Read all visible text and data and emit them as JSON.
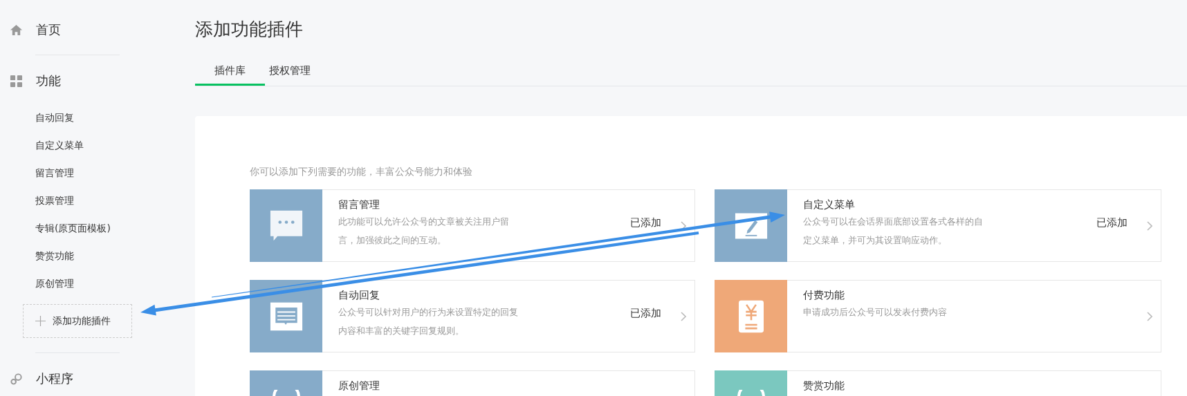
{
  "sidebar": {
    "sections": [
      {
        "kind": "home",
        "label": "首页"
      },
      {
        "kind": "grid",
        "label": "功能",
        "items": [
          {
            "label": "自动回复"
          },
          {
            "label": "自定义菜单"
          },
          {
            "label": "留言管理"
          },
          {
            "label": "投票管理"
          },
          {
            "label": "专辑(原页面模板)"
          },
          {
            "label": "赞赏功能"
          },
          {
            "label": "原创管理"
          }
        ],
        "add_button": "添加功能插件"
      },
      {
        "kind": "link",
        "label": "小程序"
      }
    ]
  },
  "page": {
    "title": "添加功能插件",
    "tabs": [
      {
        "label": "插件库",
        "selected": true
      },
      {
        "label": "授权管理",
        "selected": false
      }
    ],
    "intro": "你可以添加下列需要的功能，丰富公众号能力和体验",
    "plugins": [
      {
        "kind": "comment",
        "color": "#86abc9",
        "title": "留言管理",
        "description": "此功能可以允许公众号的文章被关注用户留言，加强彼此之间的互动。",
        "status": "已添加"
      },
      {
        "kind": "edit",
        "color": "#86abc9",
        "title": "自定义菜单",
        "description": "公众号可以在会话界面底部设置各式各样的自定义菜单，并可为其设置响应动作。",
        "status": "已添加"
      },
      {
        "kind": "message",
        "color": "#86abc9",
        "title": "自动回复",
        "description": "公众号可以针对用户的行为来设置特定的回复内容和丰富的关键字回复规则。",
        "status": "已添加"
      },
      {
        "kind": "yen",
        "color": "#efa878",
        "title": "付费功能",
        "description": "申请成功后公众号可以发表付费内容"
      },
      {
        "kind": "original",
        "color": "#86abc9",
        "title": "原创管理"
      },
      {
        "kind": "reward",
        "color": "#7bc8bf",
        "title": "赞赏功能"
      }
    ]
  }
}
